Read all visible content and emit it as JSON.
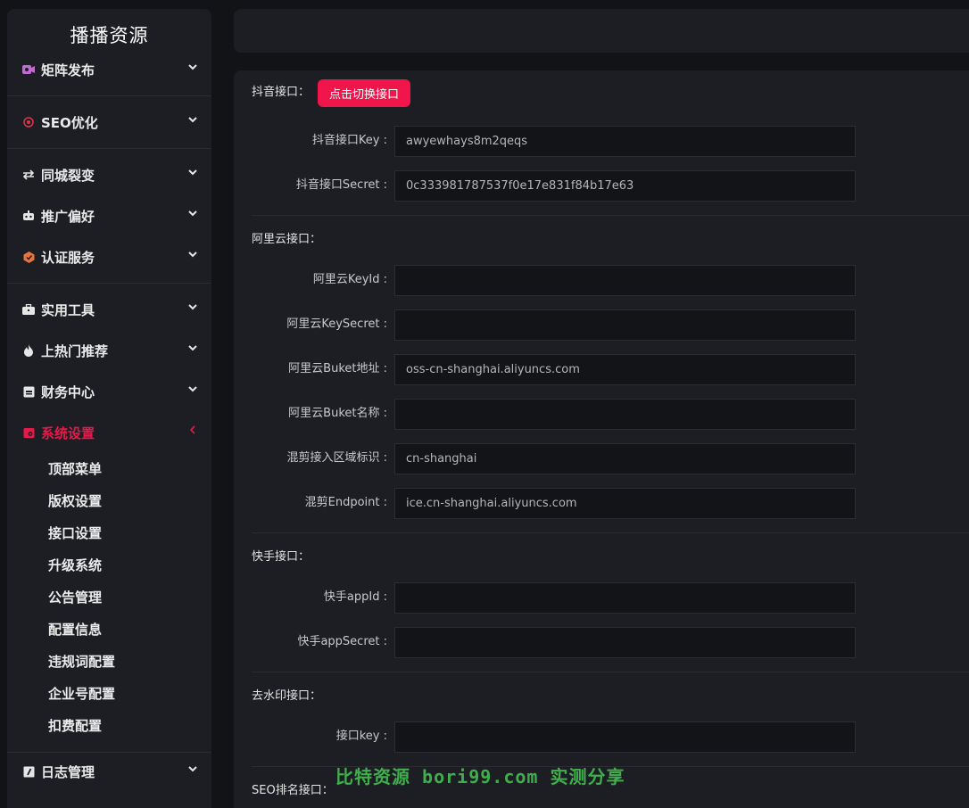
{
  "app": {
    "brand": "播播资源"
  },
  "sidebar": {
    "items": [
      {
        "label": "矩阵发布",
        "icon": "video-icon",
        "color": "#c06bd1"
      },
      {
        "label": "SEO优化",
        "icon": "target-icon",
        "color": "#e0344e"
      },
      {
        "label": "同城裂变",
        "icon": "swap-icon",
        "color": "#e6e6e6"
      },
      {
        "label": "推广偏好",
        "icon": "robot-icon",
        "color": "#e6e6e6"
      },
      {
        "label": "认证服务",
        "icon": "shield-icon",
        "color": "#e8743a"
      },
      {
        "label": "实用工具",
        "icon": "toolbox-icon",
        "color": "#e6e6e6"
      },
      {
        "label": "上热门推荐",
        "icon": "fire-icon",
        "color": "#e6e6e6"
      },
      {
        "label": "财务中心",
        "icon": "wallet-icon",
        "color": "#e6e6e6"
      },
      {
        "label": "系统设置",
        "icon": "settings-icon",
        "color": "#e8194a"
      },
      {
        "label": "日志管理",
        "icon": "log-icon",
        "color": "#e6e6e6"
      }
    ],
    "sub_items": [
      "顶部菜单",
      "版权设置",
      "接口设置",
      "升级系统",
      "公告管理",
      "配置信息",
      "违规词配置",
      "企业号配置",
      "扣费配置"
    ]
  },
  "form": {
    "douyin": {
      "title": "抖音接口：",
      "switch_button": "点击切换接口",
      "key_label": "抖音接口Key :",
      "key_value": "awyewhays8m2qeqs",
      "secret_label": "抖音接口Secret :",
      "secret_value": "0c333981787537f0e17e831f84b17e63"
    },
    "aliyun": {
      "title": "阿里云接口：",
      "keyid_label": "阿里云KeyId :",
      "keyid_value": "",
      "keysecret_label": "阿里云KeySecret :",
      "keysecret_value": "",
      "bucket_addr_label": "阿里云Buket地址 :",
      "bucket_addr_value": "oss-cn-shanghai.aliyuncs.com",
      "bucket_name_label": "阿里云Buket名称 :",
      "bucket_name_value": "",
      "region_label": "混剪接入区域标识 :",
      "region_value": "cn-shanghai",
      "endpoint_label": "混剪Endpoint :",
      "endpoint_value": "ice.cn-shanghai.aliyuncs.com"
    },
    "kuaishou": {
      "title": "快手接口：",
      "appid_label": "快手appId :",
      "appid_value": "",
      "appsecret_label": "快手appSecret :",
      "appsecret_value": ""
    },
    "watermark_api": {
      "title": "去水印接口：",
      "key_label": "接口key :",
      "key_value": ""
    },
    "seo_rank": {
      "title": "SEO排名接口："
    }
  },
  "watermark_text": "比特资源 bori99.com 实测分享"
}
